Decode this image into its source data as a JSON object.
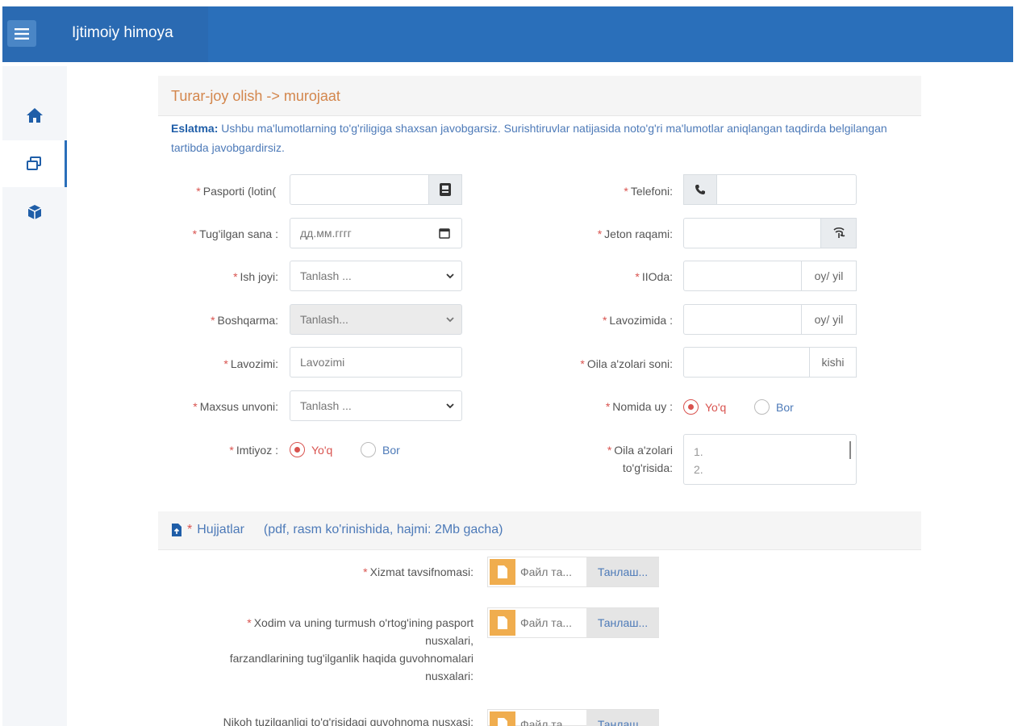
{
  "app": {
    "title": "Ijtimoiy himoya"
  },
  "colors": {
    "primary": "#2a6fba",
    "required": "#d9534f",
    "heading": "#d3864c",
    "file_icon": "#f0ad4e"
  },
  "sidebar": {
    "items": [
      {
        "icon": "home-icon"
      },
      {
        "icon": "windows-icon"
      },
      {
        "icon": "cube-icon"
      }
    ]
  },
  "page": {
    "breadcrumb": "Turar-joy olish -> murojaat",
    "note_label": "Eslatma:",
    "note_text": "Ushbu ma'lumotlarning to'g'riligiga shaxsan javobgarsiz. Surishtiruvlar natijasida noto'g'ri ma'lumotlar aniqlangan taqdirda belgilangan tartibda javobgardirsiz."
  },
  "form": {
    "req_mark": "*",
    "passport": {
      "label": "Pasporti (lotin(",
      "value": ""
    },
    "birth": {
      "label": "Tug'ilgan sana :",
      "placeholder": "дд.мм.гггг"
    },
    "workplace": {
      "label": "Ish joyi:",
      "value": "Tanlash ..."
    },
    "department": {
      "label": "Boshqarma:",
      "value": "Tanlash..."
    },
    "position": {
      "label": "Lavozimi:",
      "placeholder": "Lavozimi"
    },
    "special_rank": {
      "label": "Maxsus unvoni:",
      "value": "Tanlash ..."
    },
    "privilege": {
      "label": "Imtiyoz :",
      "options": [
        "Yo'q",
        "Bor"
      ],
      "selected": "Yo'q"
    },
    "phone": {
      "label": "Telefoni:",
      "value": ""
    },
    "token": {
      "label": "Jeton raqami:",
      "value": ""
    },
    "iioda": {
      "label": "IIOda:",
      "unit": "oy/ yil"
    },
    "in_position": {
      "label": "Lavozimida :",
      "unit": "oy/ yil"
    },
    "family_count": {
      "label": "Oila a'zolari soni:",
      "unit": "kishi"
    },
    "own_house": {
      "label": "Nomida uy :",
      "options": [
        "Yo'q",
        "Bor"
      ],
      "selected": "Yo'q"
    },
    "family_about": {
      "label_line1": "Oila a'zolari",
      "label_line2": "to'g'risida:",
      "lines": [
        "1.",
        "2."
      ]
    }
  },
  "documents": {
    "title": "Hujjatlar",
    "hint": "(pdf, rasm ko'rinishida, hajmi: 2Mb gacha)",
    "file_placeholder": "Файл та...",
    "browse_label": "Танлаш...",
    "items": [
      {
        "label": "Xizmat tavsifnomasi:"
      },
      {
        "label_lines": [
          "Xodim va uning turmush o'rtog'ining pasport",
          "nusxalari,",
          "farzandlarining tug'ilganlik haqida guvohnomalari",
          "nusxalari:"
        ]
      },
      {
        "label": "Nikoh tuzilganligi to'g'risidagi guvohnoma nusxasi:"
      }
    ]
  }
}
